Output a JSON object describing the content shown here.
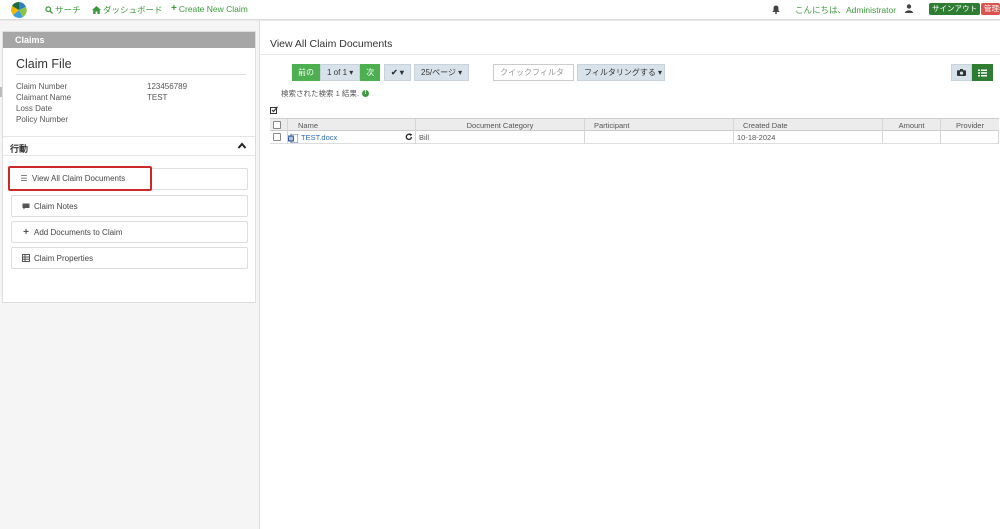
{
  "nav": {
    "search": "サーチ",
    "dashboard": "ダッシュボード",
    "create_claim": "Create New Claim",
    "greeting": "こんにちは、Administrator",
    "signout": "サインアウト",
    "admin": "管理者",
    "brand_color": "#3c9a3c"
  },
  "sidebar": {
    "header": "Claims",
    "title": "Claim File",
    "fields": [
      {
        "label": "Claim Number",
        "value": "123456789"
      },
      {
        "label": "Claimant Name",
        "value": "TEST"
      },
      {
        "label": "Loss Date",
        "value": ""
      },
      {
        "label": "Policy Number",
        "value": ""
      }
    ],
    "actions_label": "行動",
    "actions": [
      {
        "label": "View All Claim Documents",
        "icon": "list-icon",
        "active": true
      },
      {
        "label": "Claim Notes",
        "icon": "comment-icon",
        "active": false
      },
      {
        "label": "Add Documents to Claim",
        "icon": "plus-icon",
        "active": false
      },
      {
        "label": "Claim Properties",
        "icon": "table-icon",
        "active": false
      }
    ]
  },
  "main": {
    "title": "View All Claim Documents",
    "pager": {
      "prev": "前の",
      "page": "1 of 1 ▾",
      "next": "次",
      "check": "✔ ▾",
      "per_page": "25/ページ ▾"
    },
    "quick_filter_placeholder": "クイックフィルタ",
    "filter_button": "フィルタリングする ▾",
    "results_text": "検索された検索 1 結果.",
    "columns": [
      "Name",
      "Document Category",
      "Participant",
      "Created Date",
      "Amount",
      "Provider"
    ],
    "rows": [
      {
        "name": "TEST.docx",
        "category": "Bill",
        "participant": "",
        "created": "10-18-2024",
        "amount": "",
        "provider": ""
      }
    ]
  }
}
